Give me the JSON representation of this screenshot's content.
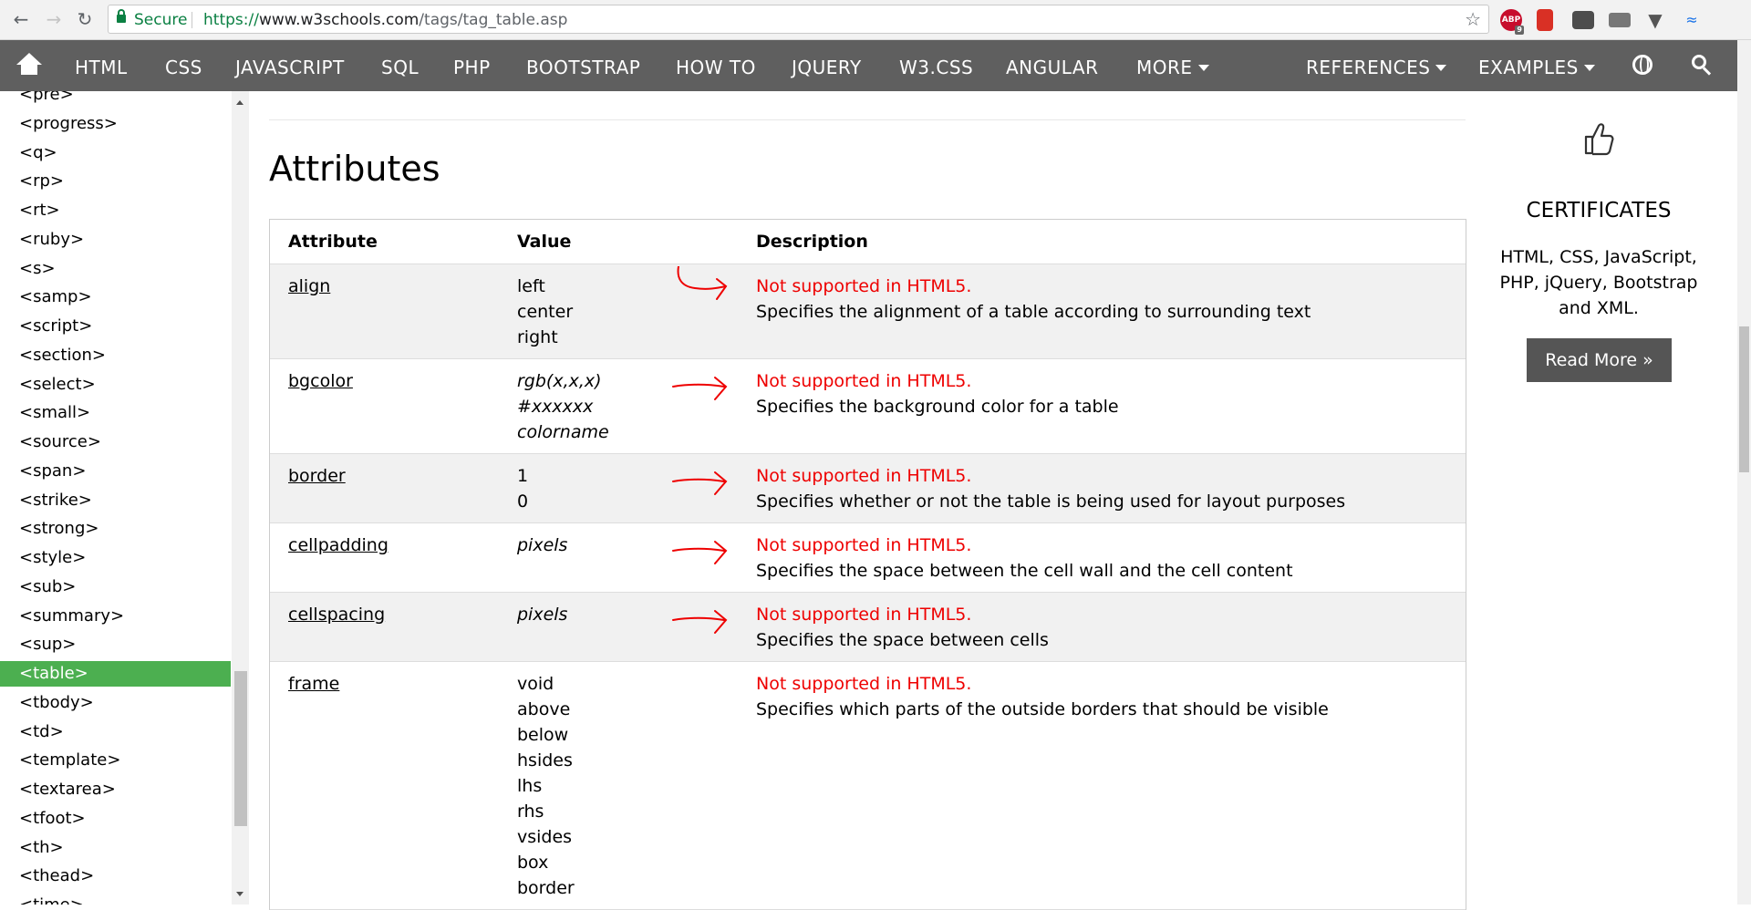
{
  "browser": {
    "secure_label": "Secure",
    "url_scheme": "https://",
    "url_host": "www.w3schools.com",
    "url_path": "/tags/tag_table.asp",
    "extensions": {
      "abp_label": "ABP",
      "abp_count": "9"
    }
  },
  "topnav": {
    "items": [
      "HTML",
      "CSS",
      "JAVASCRIPT",
      "SQL",
      "PHP",
      "BOOTSTRAP",
      "HOW TO",
      "JQUERY",
      "W3.CSS",
      "ANGULAR",
      "MORE"
    ],
    "references": "REFERENCES",
    "examples": "EXAMPLES"
  },
  "sidebar": {
    "items": [
      "<pre>",
      "<progress>",
      "<q>",
      "<rp>",
      "<rt>",
      "<ruby>",
      "<s>",
      "<samp>",
      "<script>",
      "<section>",
      "<select>",
      "<small>",
      "<source>",
      "<span>",
      "<strike>",
      "<strong>",
      "<style>",
      "<sub>",
      "<summary>",
      "<sup>",
      "<table>",
      "<tbody>",
      "<td>",
      "<template>",
      "<textarea>",
      "<tfoot>",
      "<th>",
      "<thead>",
      "<time>"
    ],
    "active_item": "<table>"
  },
  "main": {
    "heading": "Attributes",
    "table": {
      "headers": {
        "attribute": "Attribute",
        "value": "Value",
        "description": "Description"
      },
      "rows": [
        {
          "attribute": "align",
          "values": [
            "left",
            "center",
            "right"
          ],
          "italic": false,
          "note": "Not supported in HTML5.",
          "description": "Specifies the alignment of a table according to surrounding text"
        },
        {
          "attribute": "bgcolor",
          "values": [
            "rgb(x,x,x)",
            "#xxxxxx",
            "colorname"
          ],
          "italic": true,
          "note": "Not supported in HTML5.",
          "description": "Specifies the background color for a table"
        },
        {
          "attribute": "border",
          "values": [
            "1",
            "0"
          ],
          "italic": false,
          "note": "Not supported in HTML5.",
          "description": "Specifies whether or not the table is being used for layout purposes"
        },
        {
          "attribute": "cellpadding",
          "values": [
            "pixels"
          ],
          "italic": true,
          "note": "Not supported in HTML5.",
          "description": "Specifies the space between the cell wall and the cell content"
        },
        {
          "attribute": "cellspacing",
          "values": [
            "pixels"
          ],
          "italic": true,
          "note": "Not supported in HTML5.",
          "description": "Specifies the space between cells"
        },
        {
          "attribute": "frame",
          "values": [
            "void",
            "above",
            "below",
            "hsides",
            "lhs",
            "rhs",
            "vsides",
            "box",
            "border"
          ],
          "italic": false,
          "note": "Not supported in HTML5.",
          "description": "Specifies which parts of the outside borders that should be visible"
        }
      ]
    }
  },
  "right": {
    "cert_title": "CERTIFICATES",
    "cert_text": "HTML, CSS, JavaScript, PHP, jQuery, Bootstrap and XML.",
    "read_more": "Read More »"
  },
  "colors": {
    "active_green": "#4caf50",
    "navbar": "#5f5f5f",
    "warning_red": "#e00000"
  },
  "icons": [
    "back-icon",
    "forward-icon",
    "reload-icon",
    "lock-icon",
    "star-icon",
    "home-icon",
    "globe-icon",
    "search-icon",
    "thumbs-up-icon",
    "red-arrow-annotation"
  ]
}
